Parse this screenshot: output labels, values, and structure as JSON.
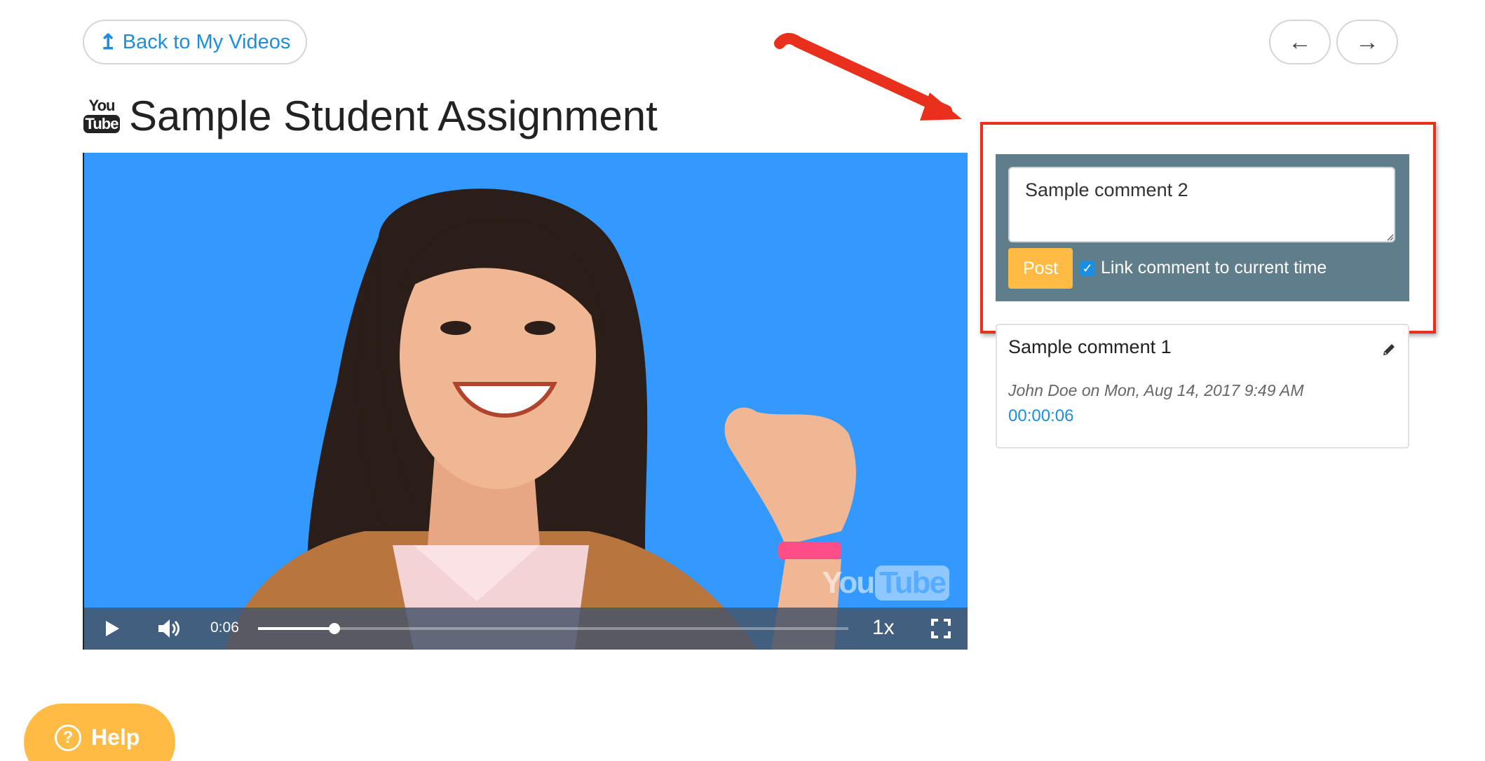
{
  "nav": {
    "back_label": "Back to My Videos",
    "back_icon": "up-arrow-icon",
    "prev_label": "←",
    "next_label": "→"
  },
  "header": {
    "title": "Sample Student Assignment",
    "source_icon": "youtube-icon",
    "source_icon_top": "You",
    "source_icon_bottom": "Tube"
  },
  "player": {
    "current_time": "0:06",
    "progress": 0.13,
    "speed": "1x",
    "watermark_you": "You",
    "watermark_tube": "Tube",
    "background_color": "#3399ff"
  },
  "comment_form": {
    "input_value": "Sample comment 2",
    "post_label": "Post",
    "link_checked": true,
    "link_label": "Link comment to current time",
    "background_color": "#607d8b",
    "post_color": "#ffbb44"
  },
  "comments": [
    {
      "text": "Sample comment 1",
      "meta": "John Doe on Mon, Aug 14, 2017 9:49 AM",
      "timestamp": "00:00:06"
    }
  ],
  "help": {
    "label": "Help",
    "icon_glyph": "?"
  },
  "annotation": {
    "color": "#e8301c"
  }
}
